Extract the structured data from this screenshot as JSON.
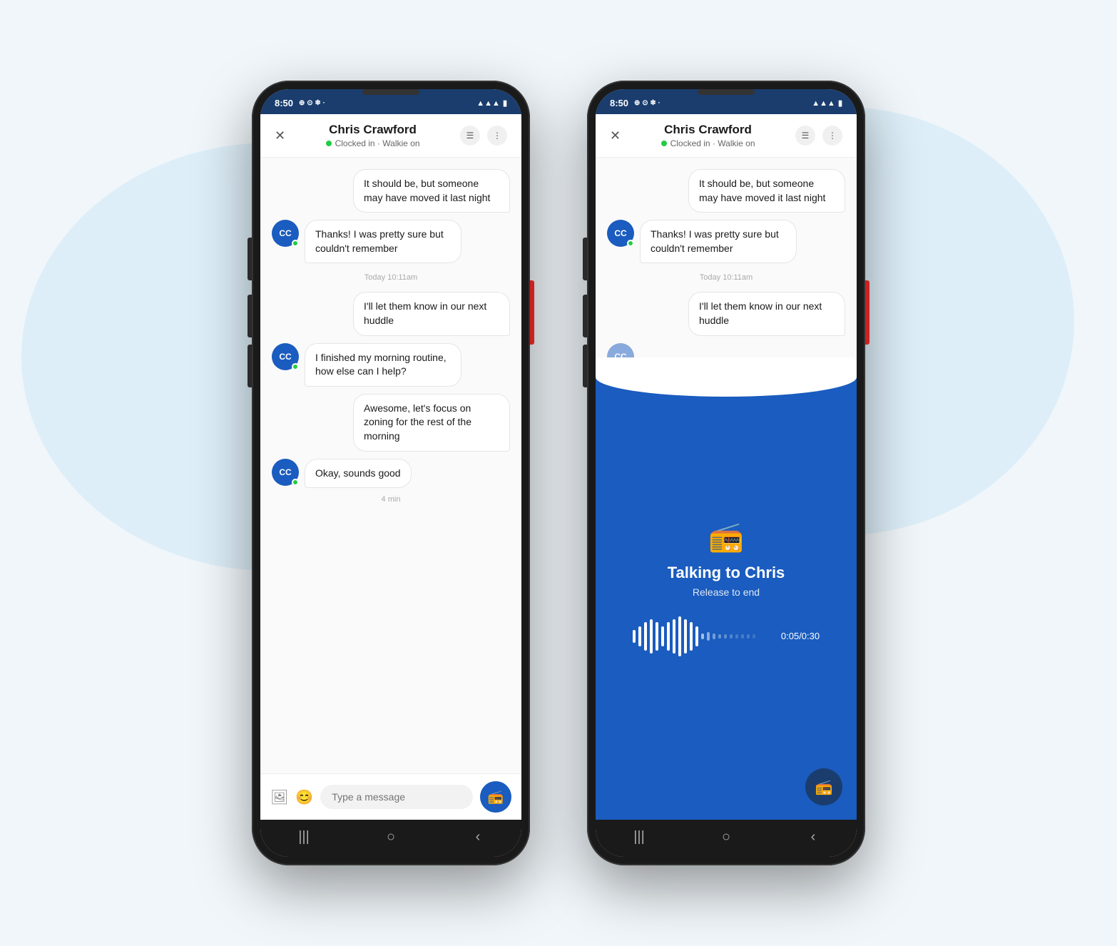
{
  "background": {
    "blob_color": "#ddeef8"
  },
  "phone1": {
    "status_bar": {
      "time": "8:50",
      "icons_left": "⊕ ⊙ ❄ ·",
      "icons_right": "📶 · ↑"
    },
    "header": {
      "close_label": "✕",
      "name": "Chris Crawford",
      "status": "Clocked in · Walkie on",
      "icon1": "☰",
      "icon2": "⋮"
    },
    "messages": [
      {
        "type": "sent",
        "text": "It should be, but someone may have moved it last night"
      },
      {
        "type": "received",
        "avatar": "CC",
        "text": "Thanks! I was pretty sure but couldn't remember"
      },
      {
        "type": "timestamp",
        "text": "Today 10:11am"
      },
      {
        "type": "sent",
        "text": "I'll let them know in our next huddle"
      },
      {
        "type": "received",
        "avatar": "CC",
        "text": "I finished my morning routine, how else can I help?"
      },
      {
        "type": "sent",
        "text": "Awesome, let's focus on zoning for the rest of the morning"
      },
      {
        "type": "received",
        "avatar": "CC",
        "text": "Okay, sounds good"
      },
      {
        "type": "minute",
        "text": "4 min"
      }
    ],
    "input": {
      "placeholder": "Type a message",
      "icon_photo": "🖼",
      "icon_emoji": "😊",
      "walkie_icon": "📻"
    },
    "bottom_nav": {
      "items": [
        "|||",
        "○",
        "‹"
      ]
    }
  },
  "phone2": {
    "status_bar": {
      "time": "8:50",
      "icons_left": "⊕ ⊙ ❄ ·",
      "icons_right": "📶 · ↑"
    },
    "header": {
      "close_label": "✕",
      "name": "Chris Crawford",
      "status": "Clocked in · Walkie on",
      "icon1": "☰",
      "icon2": "⋮"
    },
    "messages": [
      {
        "type": "sent",
        "text": "It should be, but someone may have moved it last night"
      },
      {
        "type": "received",
        "avatar": "CC",
        "text": "Thanks! I was pretty sure but couldn't remember"
      },
      {
        "type": "timestamp",
        "text": "Today 10:11am"
      },
      {
        "type": "sent",
        "text": "I'll let them know in our next huddle"
      }
    ],
    "walkie": {
      "title": "Talking to Chris",
      "subtitle": "Release to end",
      "timer": "0:05/0:30",
      "wave_heights": [
        18,
        28,
        38,
        48,
        38,
        28,
        38,
        48,
        56,
        48,
        38,
        28,
        18,
        12,
        10,
        8,
        8,
        8,
        8
      ]
    },
    "bottom_nav": {
      "items": [
        "|||",
        "○",
        "‹"
      ]
    }
  }
}
